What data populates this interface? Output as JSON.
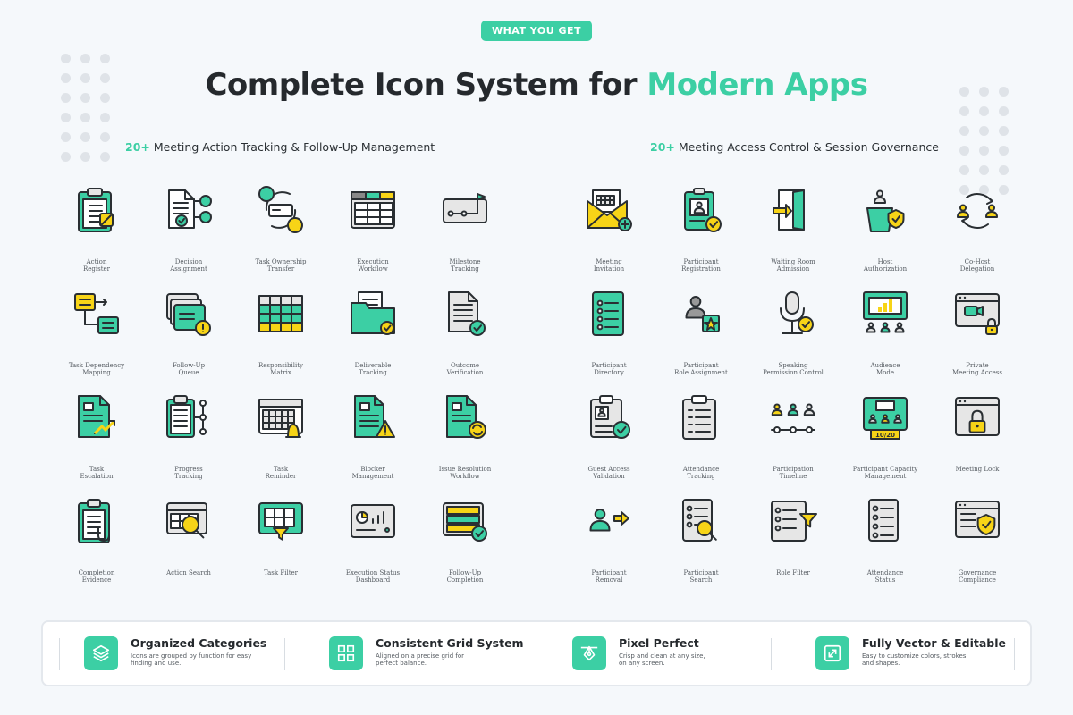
{
  "badge": "WHAT YOU GET",
  "title": {
    "main": "Complete Icon System for ",
    "accent": "Modern Apps"
  },
  "colors": {
    "accent": "#3ccfa4",
    "yellow": "#f7d417",
    "gray": "#e6e6e6",
    "outline": "#2a2f33"
  },
  "left_section": {
    "count": "20+",
    "heading": "Meeting Action Tracking & Follow-Up Management",
    "icons": [
      {
        "label": "Action\nRegister",
        "icon": "clipboard-pencil-icon"
      },
      {
        "label": "Decision\nAssignment",
        "icon": "document-users-icon"
      },
      {
        "label": "Task Ownership\nTransfer",
        "icon": "user-transfer-icon"
      },
      {
        "label": "Execution\nWorkflow",
        "icon": "kanban-board-icon"
      },
      {
        "label": "Milestone\nTracking",
        "icon": "milestone-flag-icon"
      },
      {
        "label": "Task Dependency\nMapping",
        "icon": "flow-chart-icon"
      },
      {
        "label": "Follow-Up\nQueue",
        "icon": "stacked-cards-alert-icon"
      },
      {
        "label": "Responsibility\nMatrix",
        "icon": "matrix-table-icon"
      },
      {
        "label": "Deliverable\nTracking",
        "icon": "folder-check-icon"
      },
      {
        "label": "Outcome\nVerification",
        "icon": "document-check-icon"
      },
      {
        "label": "Task\nEscalation",
        "icon": "document-trend-icon"
      },
      {
        "label": "Progress\nTracking",
        "icon": "checklist-timeline-icon"
      },
      {
        "label": "Task\nReminder",
        "icon": "calendar-bell-icon"
      },
      {
        "label": "Blocker\nManagement",
        "icon": "document-warning-icon"
      },
      {
        "label": "Issue Resolution\nWorkflow",
        "icon": "document-refresh-icon"
      },
      {
        "label": "Completion\nEvidence",
        "icon": "clipboard-attachment-icon"
      },
      {
        "label": "Action Search",
        "icon": "table-search-icon"
      },
      {
        "label": "Task Filter",
        "icon": "grid-filter-icon"
      },
      {
        "label": "Execution Status\nDashboard",
        "icon": "dashboard-chart-icon"
      },
      {
        "label": "Follow-Up\nCompletion",
        "icon": "list-check-icon"
      }
    ]
  },
  "right_section": {
    "count": "20+",
    "heading": "Meeting Access Control & Session Governance",
    "icons": [
      {
        "label": "Meeting\nInvitation",
        "icon": "envelope-calendar-icon"
      },
      {
        "label": "Participant\nRegistration",
        "icon": "id-badge-check-icon"
      },
      {
        "label": "Waiting Room\nAdmission",
        "icon": "door-arrow-icon"
      },
      {
        "label": "Host\nAuthorization",
        "icon": "podium-shield-icon"
      },
      {
        "label": "Co-Host\nDelegation",
        "icon": "users-cycle-icon"
      },
      {
        "label": "Participant\nDirectory",
        "icon": "document-list-icon"
      },
      {
        "label": "Participant\nRole Assignment",
        "icon": "user-star-icon"
      },
      {
        "label": "Speaking\nPermission Control",
        "icon": "microphone-check-icon"
      },
      {
        "label": "Audience\nMode",
        "icon": "presentation-audience-icon"
      },
      {
        "label": "Private\nMeeting Access",
        "icon": "browser-camera-lock-icon"
      },
      {
        "label": "Guest Access\nValidation",
        "icon": "clipboard-user-check-icon"
      },
      {
        "label": "Attendance\nTracking",
        "icon": "clipboard-checklist-icon"
      },
      {
        "label": "Participation\nTimeline",
        "icon": "users-timeline-icon"
      },
      {
        "label": "Participant Capacity\nManagement",
        "icon": "room-capacity-icon"
      },
      {
        "label": "Meeting Lock",
        "icon": "browser-lock-icon"
      },
      {
        "label": "Participant\nRemoval",
        "icon": "user-remove-arrow-icon"
      },
      {
        "label": "Participant\nSearch",
        "icon": "document-search-icon"
      },
      {
        "label": "Role Filter",
        "icon": "list-filter-icon"
      },
      {
        "label": "Attendance\nStatus",
        "icon": "document-status-icon"
      },
      {
        "label": "Governance\nCompliance",
        "icon": "browser-shield-icon"
      }
    ],
    "capacity_text": "10/20"
  },
  "features": [
    {
      "title": "Organized Categories",
      "desc": "Icons are grouped by function for easy\nfinding and use.",
      "icon": "layers-icon"
    },
    {
      "title": "Consistent Grid System",
      "desc": "Aligned on a precise grid for\nperfect balance.",
      "icon": "grid-icon"
    },
    {
      "title": "Pixel Perfect",
      "desc": "Crisp and clean at any size,\non any screen.",
      "icon": "pen-tool-icon"
    },
    {
      "title": "Fully Vector & Editable",
      "desc": "Easy to customize colors, strokes\nand shapes.",
      "icon": "resize-icon"
    }
  ]
}
